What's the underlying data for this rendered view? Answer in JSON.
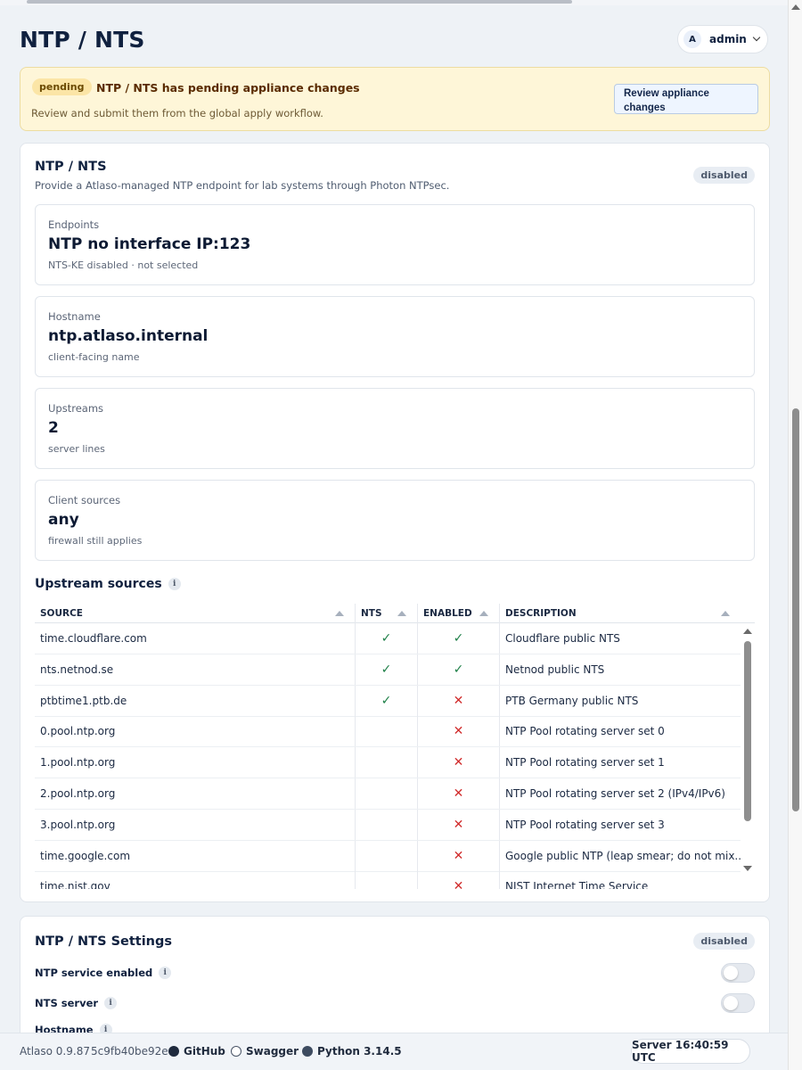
{
  "header": {
    "title": "NTP / NTS",
    "user": {
      "avatar_letter": "A",
      "name": "admin"
    }
  },
  "banner": {
    "badge": "pending",
    "title": "NTP / NTS has pending appliance changes",
    "subtitle": "Review and submit them from the global apply workflow.",
    "button": "Review appliance changes"
  },
  "main_card": {
    "title": "NTP / NTS",
    "subtitle": "Provide a Atlaso-managed NTP endpoint for lab systems through Photon NTPsec.",
    "status": "disabled",
    "stats": [
      {
        "label": "Endpoints",
        "value": "NTP no interface IP:123",
        "hint": "NTS-KE disabled · not selected"
      },
      {
        "label": "Hostname",
        "value": "ntp.atlaso.internal",
        "hint": "client-facing name"
      },
      {
        "label": "Upstreams",
        "value": "2",
        "hint": "server lines"
      },
      {
        "label": "Client sources",
        "value": "any",
        "hint": "firewall still applies"
      }
    ],
    "upstream_title": "Upstream sources",
    "columns": [
      "SOURCE",
      "NTS",
      "ENABLED",
      "DESCRIPTION"
    ],
    "rows": [
      {
        "source": "time.cloudflare.com",
        "nts": true,
        "enabled": true,
        "description": "Cloudflare public NTS"
      },
      {
        "source": "nts.netnod.se",
        "nts": true,
        "enabled": true,
        "description": "Netnod public NTS"
      },
      {
        "source": "ptbtime1.ptb.de",
        "nts": true,
        "enabled": false,
        "description": "PTB Germany public NTS"
      },
      {
        "source": "0.pool.ntp.org",
        "nts": false,
        "enabled": false,
        "description": "NTP Pool rotating server set 0"
      },
      {
        "source": "1.pool.ntp.org",
        "nts": false,
        "enabled": false,
        "description": "NTP Pool rotating server set 1"
      },
      {
        "source": "2.pool.ntp.org",
        "nts": false,
        "enabled": false,
        "description": "NTP Pool rotating server set 2 (IPv4/IPv6)"
      },
      {
        "source": "3.pool.ntp.org",
        "nts": false,
        "enabled": false,
        "description": "NTP Pool rotating server set 3"
      },
      {
        "source": "time.google.com",
        "nts": false,
        "enabled": false,
        "description": "Google public NTP (leap smear; do not mix..."
      },
      {
        "source": "time.nist.gov",
        "nts": false,
        "enabled": false,
        "description": "NIST Internet Time Service"
      }
    ],
    "symbols": {
      "check": "✓",
      "cross": "✕"
    }
  },
  "settings_card": {
    "title": "NTP / NTS Settings",
    "status": "disabled",
    "items": [
      {
        "label": "NTP service enabled",
        "on": false
      },
      {
        "label": "NTS server",
        "on": false
      },
      {
        "label": "Hostname"
      }
    ]
  },
  "footer": {
    "version": "Atlaso 0.9.87",
    "commit": "5c9fb40be92e",
    "github": "GitHub",
    "swagger": "Swagger",
    "python": "Python 3.14.5",
    "server_time": "Server 16:40:59 UTC"
  },
  "colors": {
    "check": "#208149",
    "cross": "#d12d2d",
    "banner_bg": "#fef6d8",
    "accent": "#10213f"
  }
}
